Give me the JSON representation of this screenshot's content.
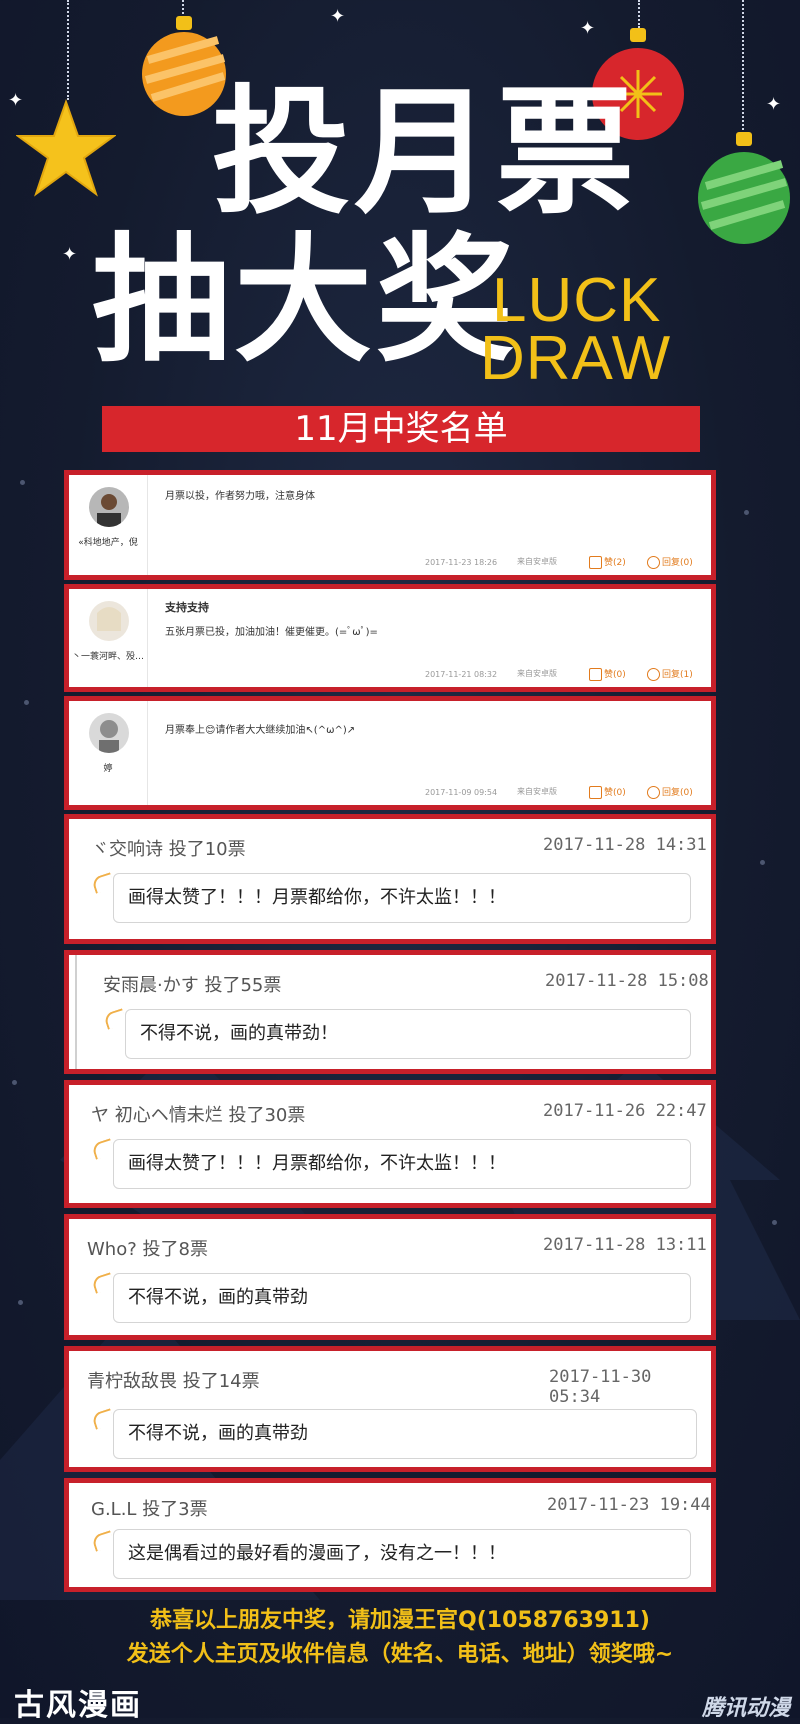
{
  "header": {
    "title_line1": "投月票",
    "title_line2": "抽大奖",
    "luck": "LUCK",
    "draw": "DRAW"
  },
  "banner": "11月中奖名单",
  "colors": {
    "accent_red": "#d7262c",
    "gold": "#f2c018",
    "bg": "#141b2e"
  },
  "comments_a": [
    {
      "username": "«科地地产，倪",
      "title": "",
      "text": "月票以投，作者努力哦，注意身体",
      "timestamp": "2017-11-23 18:26",
      "source": "来自安卓版",
      "likes": "赞(2)",
      "replies": "回复(0)"
    },
    {
      "username": "丶一蓑河畔、殁…",
      "title": "支持支持",
      "text": "五张月票已投，加油加油！催更催更。(=ﾟωﾟ)=",
      "timestamp": "2017-11-21 08:32",
      "source": "来自安卓版",
      "likes": "赞(0)",
      "replies": "回复(1)"
    },
    {
      "username": "婷",
      "title": "",
      "text": "月票奉上😊请作者大大继续加油↖(^ω^)↗",
      "timestamp": "2017-11-09 09:54",
      "source": "来自安卓版",
      "likes": "赞(0)",
      "replies": "回复(0)"
    }
  ],
  "comments_b": [
    {
      "user": "ヾ交响诗",
      "votes": "投了10票",
      "timestamp": "2017-11-28 14:31",
      "text": "画得太赞了！！！月票都给你，不许太监！！！"
    },
    {
      "user": "安雨晨·かす",
      "votes": "投了55票",
      "timestamp": "2017-11-28 15:08",
      "text": "不得不说，画的真带劲！"
    },
    {
      "user": "ヤ 初心ヘ情未烂",
      "votes": "投了30票",
      "timestamp": "2017-11-26 22:47",
      "text": "画得太赞了！！！月票都给你，不许太监！！！"
    },
    {
      "user": "Who?",
      "votes": "投了8票",
      "timestamp": "2017-11-28 13:11",
      "text": "不得不说，画的真带劲"
    },
    {
      "user": "青柠敌敌畏",
      "votes": "投了14票",
      "timestamp": "2017-11-30 05:34",
      "text": "不得不说，画的真带劲"
    },
    {
      "user": "G.L.L",
      "votes": "投了3票",
      "timestamp": "2017-11-23 19:44",
      "text": "这是偶看过的最好看的漫画了，没有之一！！！"
    }
  ],
  "footer": {
    "line1": "恭喜以上朋友中奖，请加漫王官Q(1058763911)",
    "line2": "发送个人主页及收件信息（姓名、电话、地址）领奖哦~"
  },
  "logos": {
    "left": "古风漫画",
    "right": "腾讯动漫"
  }
}
